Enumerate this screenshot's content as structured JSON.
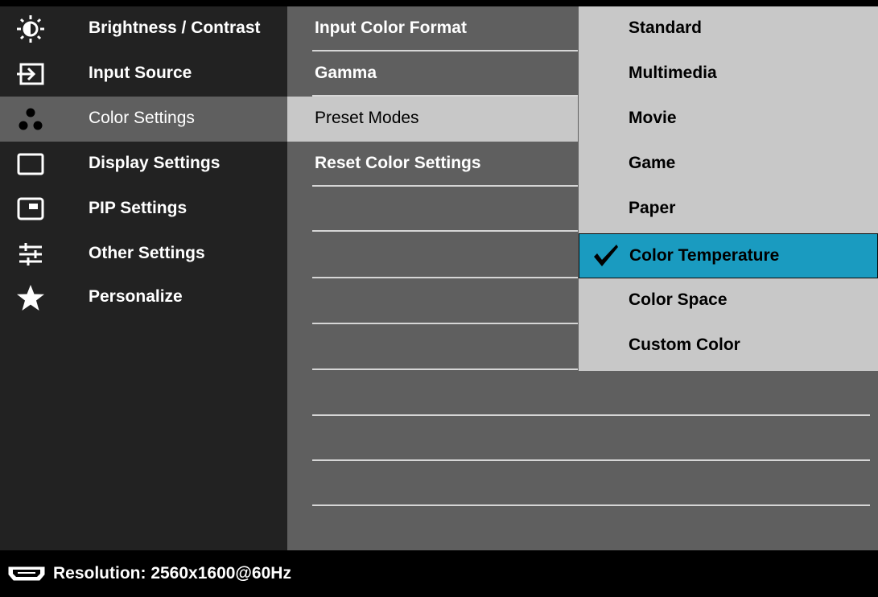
{
  "menu": {
    "items": [
      {
        "label": "Brightness / Contrast",
        "icon": "brightness-icon"
      },
      {
        "label": "Input Source",
        "icon": "input-source-icon"
      },
      {
        "label": "Color Settings",
        "icon": "color-settings-icon",
        "selected": true
      },
      {
        "label": "Display Settings",
        "icon": "display-settings-icon"
      },
      {
        "label": "PIP Settings",
        "icon": "pip-icon"
      },
      {
        "label": "Other Settings",
        "icon": "sliders-icon"
      },
      {
        "label": "Personalize",
        "icon": "star-icon"
      }
    ]
  },
  "submenu": {
    "items": [
      {
        "label": "Input Color Format"
      },
      {
        "label": "Gamma"
      },
      {
        "label": "Preset Modes",
        "selected": true
      },
      {
        "label": "Reset Color Settings"
      }
    ]
  },
  "options": {
    "items": [
      {
        "label": "Standard"
      },
      {
        "label": "Multimedia"
      },
      {
        "label": "Movie"
      },
      {
        "label": "Game"
      },
      {
        "label": "Paper"
      },
      {
        "label": "Color Temperature",
        "selected": true,
        "checked_icon": "checkmark-icon"
      },
      {
        "label": "Color Space"
      },
      {
        "label": "Custom Color"
      }
    ]
  },
  "status": {
    "resolution": "Resolution: 2560x1600@60Hz",
    "input_icon": "hdmi-port-icon"
  },
  "colors": {
    "left_bg": "#222222",
    "mid_bg": "#5f5f5f",
    "right_bg": "#c8c8c8",
    "highlight": "#1a9bc0"
  }
}
